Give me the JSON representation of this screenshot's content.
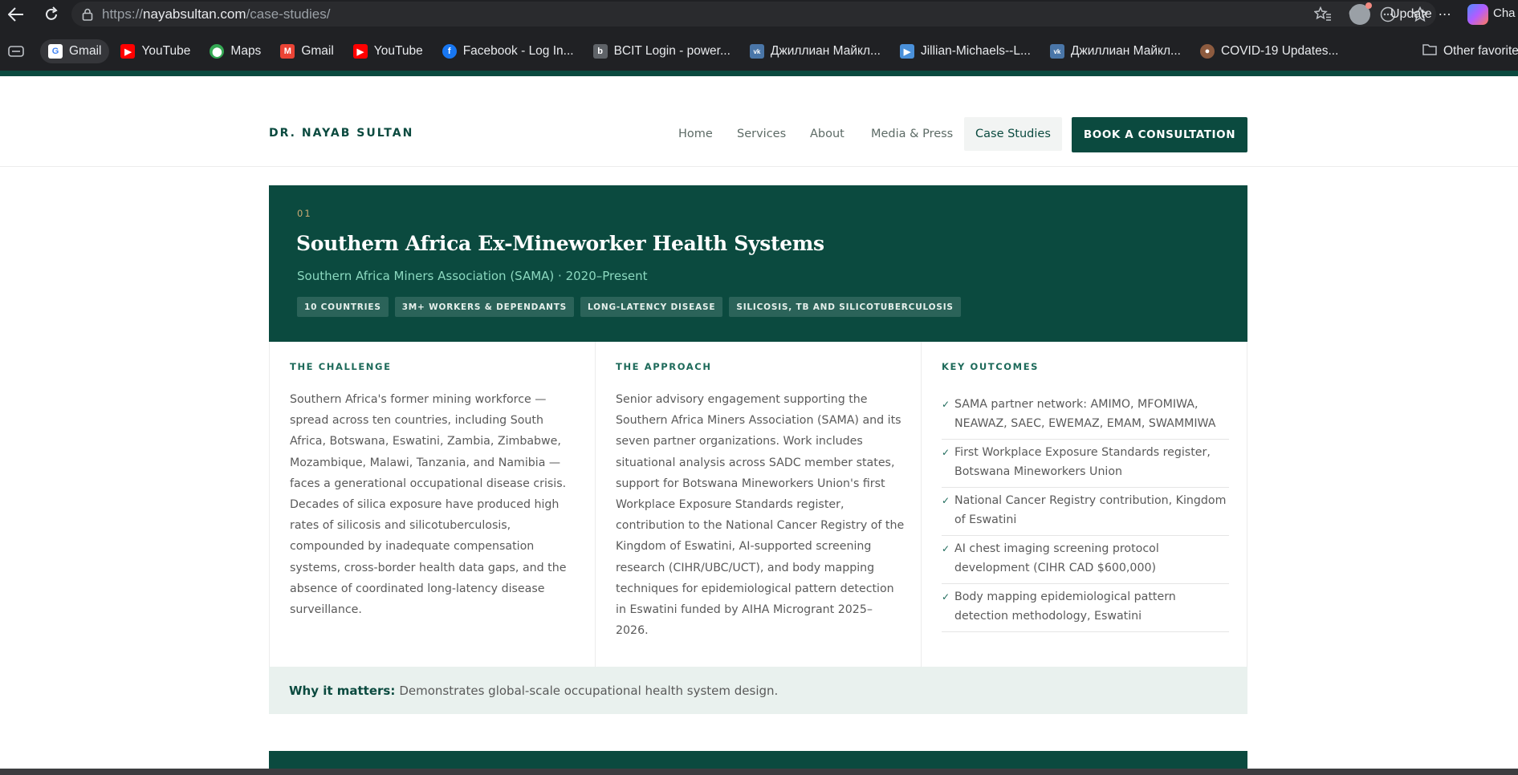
{
  "browser": {
    "url_scheme": "https://",
    "url_host": "nayabsultan.com",
    "url_path": "/case-studies/",
    "update_label": "Update",
    "truncated_tab": "Cha",
    "bookmarks": [
      {
        "label": "Gmail",
        "icon": "google-icon",
        "color": "#ffffff"
      },
      {
        "label": "YouTube",
        "icon": "youtube-icon",
        "color": "#ff0000"
      },
      {
        "label": "Maps",
        "icon": "maps-icon",
        "color": "#34a853"
      },
      {
        "label": "Gmail",
        "icon": "gmail-icon",
        "color": "#ea4335"
      },
      {
        "label": "YouTube",
        "icon": "youtube-icon",
        "color": "#ff0000"
      },
      {
        "label": "Facebook - Log In...",
        "icon": "facebook-icon",
        "color": "#1877f2"
      },
      {
        "label": "BCIT Login - power...",
        "icon": "bcit-icon",
        "color": "#5f6368"
      },
      {
        "label": "Джиллиан Майкл...",
        "icon": "vk-icon",
        "color": "#4a76a8"
      },
      {
        "label": "Jillian-Michaels--L...",
        "icon": "video-icon",
        "color": "#4a90d9"
      },
      {
        "label": "Джиллиан Майкл...",
        "icon": "vk-icon",
        "color": "#4a76a8"
      },
      {
        "label": "COVID-19 Updates...",
        "icon": "avatar-icon",
        "color": "#8d5b3f"
      }
    ],
    "other_favorites": "Other favorites"
  },
  "site": {
    "brand": "DR. NAYAB SULTAN",
    "nav": [
      {
        "label": "Home"
      },
      {
        "label": "Services"
      },
      {
        "label": "About"
      },
      {
        "label": "Media & Press"
      },
      {
        "label": "Case Studies",
        "active": true
      }
    ],
    "cta": "BOOK A CONSULTATION",
    "accent_color": "#0b4a3f"
  },
  "case": {
    "number": "01",
    "title": "Southern Africa Ex-Mineworker Health Systems",
    "subtitle": "Southern Africa Miners Association (SAMA) · 2020–Present",
    "tags": [
      "10 COUNTRIES",
      "3M+ WORKERS & DEPENDANTS",
      "LONG-LATENCY DISEASE",
      "SILICOSIS, TB AND SILICOTUBERCULOSIS"
    ],
    "challenge": {
      "heading": "THE CHALLENGE",
      "text": "Southern Africa's former mining workforce — spread across ten countries, including South Africa, Botswana, Eswatini, Zambia, Zimbabwe, Mozambique, Malawi, Tanzania, and Namibia — faces a generational occupational disease crisis. Decades of silica exposure have produced high rates of silicosis and silicotuberculosis, compounded by inadequate compensation systems, cross-border health data gaps, and the absence of coordinated long-latency disease surveillance."
    },
    "approach": {
      "heading": "THE APPROACH",
      "text": "Senior advisory engagement supporting the Southern Africa Miners Association (SAMA) and its seven partner organizations. Work includes situational analysis across SADC member states, support for Botswana Mineworkers Union's first Workplace Exposure Standards register, contribution to the National Cancer Registry of the Kingdom of Eswatini, AI-supported screening research (CIHR/UBC/UCT), and body mapping techniques for epidemiological pattern detection in Eswatini funded by AIHA Microgrant 2025–2026."
    },
    "outcomes": {
      "heading": "KEY OUTCOMES",
      "items": [
        "SAMA partner network: AMIMO, MFOMIWA, NEAWAZ, SAEC, EWEMAZ, EMAM, SWAMMIWA",
        "First Workplace Exposure Standards register, Botswana Mineworkers Union",
        "National Cancer Registry contribution, Kingdom of Eswatini",
        "AI chest imaging screening protocol development (CIHR CAD $600,000)",
        "Body mapping epidemiological pattern detection methodology, Eswatini"
      ]
    },
    "why_label": "Why it matters:",
    "why_text": "Demonstrates global-scale occupational health system design."
  }
}
